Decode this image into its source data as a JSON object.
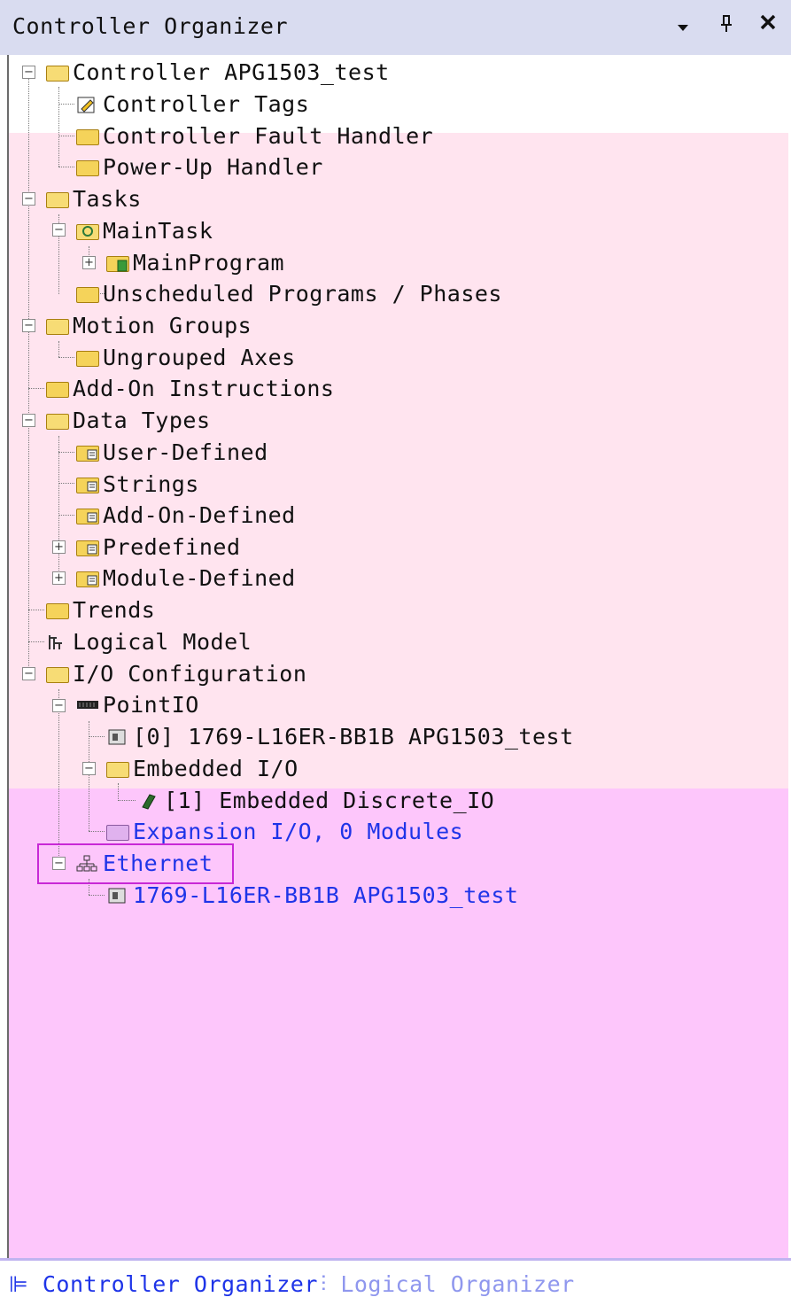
{
  "panel": {
    "title": "Controller Organizer",
    "dropdown_icon": "chevron-down-icon",
    "pin_icon": "pin-icon",
    "close_icon": "close-icon"
  },
  "tree": {
    "controller": "Controller APG1503_test",
    "controller_tags": "Controller Tags",
    "fault_handler": "Controller Fault Handler",
    "powerup_handler": "Power-Up Handler",
    "tasks": "Tasks",
    "main_task": "MainTask",
    "main_program": "MainProgram",
    "unscheduled": "Unscheduled Programs / Phases",
    "motion_groups": "Motion Groups",
    "ungrouped_axes": "Ungrouped Axes",
    "add_on_instructions": "Add-On Instructions",
    "data_types": "Data Types",
    "user_defined": "User-Defined",
    "strings": "Strings",
    "add_on_defined": "Add-On-Defined",
    "predefined": "Predefined",
    "module_defined": "Module-Defined",
    "trends": "Trends",
    "logical_model": "Logical Model",
    "io_configuration": "I/O Configuration",
    "point_io": "PointIO",
    "module_0": "[0] 1769-L16ER-BB1B APG1503_test",
    "embedded_io": "Embedded I/O",
    "embedded_discrete": "[1] Embedded Discrete_IO",
    "expansion_io": "Expansion I/O, 0 Modules",
    "ethernet": "Ethernet",
    "ethernet_module": "1769-L16ER-BB1B APG1503_test"
  },
  "tabs": {
    "controller_organizer": "Controller Organizer",
    "logical_organizer": "Logical Organizer"
  },
  "colors": {
    "selection_border": "#c828d6",
    "link_blue": "#1e34e8",
    "overlay_pink": "#ffe4ef",
    "overlay_violet": "#fdc6fb"
  }
}
